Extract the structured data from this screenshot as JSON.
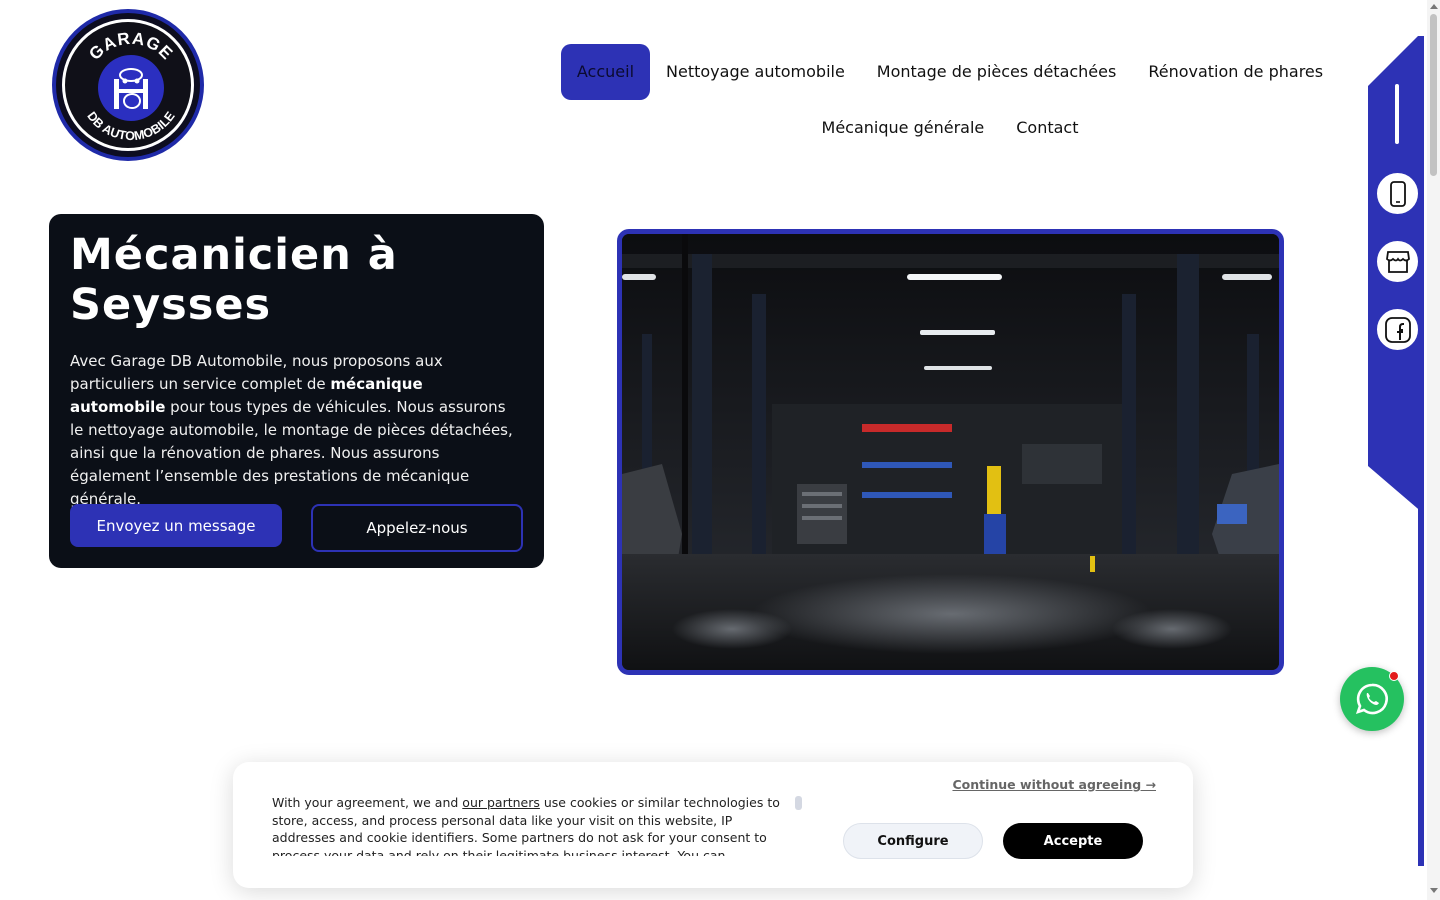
{
  "logo": {
    "text_top": "GARAGE",
    "text_bottom": "DB AUTOMOBILE",
    "icon": "car-lift-logo-icon"
  },
  "nav": {
    "items": [
      {
        "label": "Accueil",
        "active": true
      },
      {
        "label": "Nettoyage automobile",
        "active": false
      },
      {
        "label": "Montage de pièces détachées",
        "active": false
      },
      {
        "label": "Rénovation de phares",
        "active": false
      },
      {
        "label": "Mécanique générale",
        "active": false
      },
      {
        "label": "Contact",
        "active": false
      }
    ]
  },
  "hero": {
    "title_line1": "Mécanicien à",
    "title_line2": "Seysses",
    "desc_part1": "Avec Garage DB Automobile, nous proposons aux particuliers un service complet de ",
    "desc_bold": "mécanique automobile",
    "desc_part2": " pour tous types de véhicules. Nous assurons le nettoyage automobile, le montage de pièces détachées, ainsi que la rénovation de phares. Nous assurons également l’ensemble des prestations de mécanique générale.",
    "btn_message": "Envoyez un message",
    "btn_call": "Appelez-nous"
  },
  "side_icons": [
    "phone-icon",
    "storefront-icon",
    "facebook-icon"
  ],
  "whatsapp": {
    "icon": "whatsapp-icon",
    "notification": true
  },
  "cookie": {
    "text_before_link": "With your agreement, we and ",
    "link": "our partners",
    "text_after_link": " use cookies or similar technologies to store, access, and process personal data like your visit on this website, IP addresses and cookie identifiers. Some partners do not ask for your consent to process your data and rely on their legitimate business interest. You can",
    "continue": "Continue without agreeing →",
    "configure": "Configure",
    "accept": "Accepte"
  },
  "colors": {
    "brand": "#2d32b5",
    "hero_bg": "#0b0f17",
    "whatsapp": "#25c160"
  }
}
